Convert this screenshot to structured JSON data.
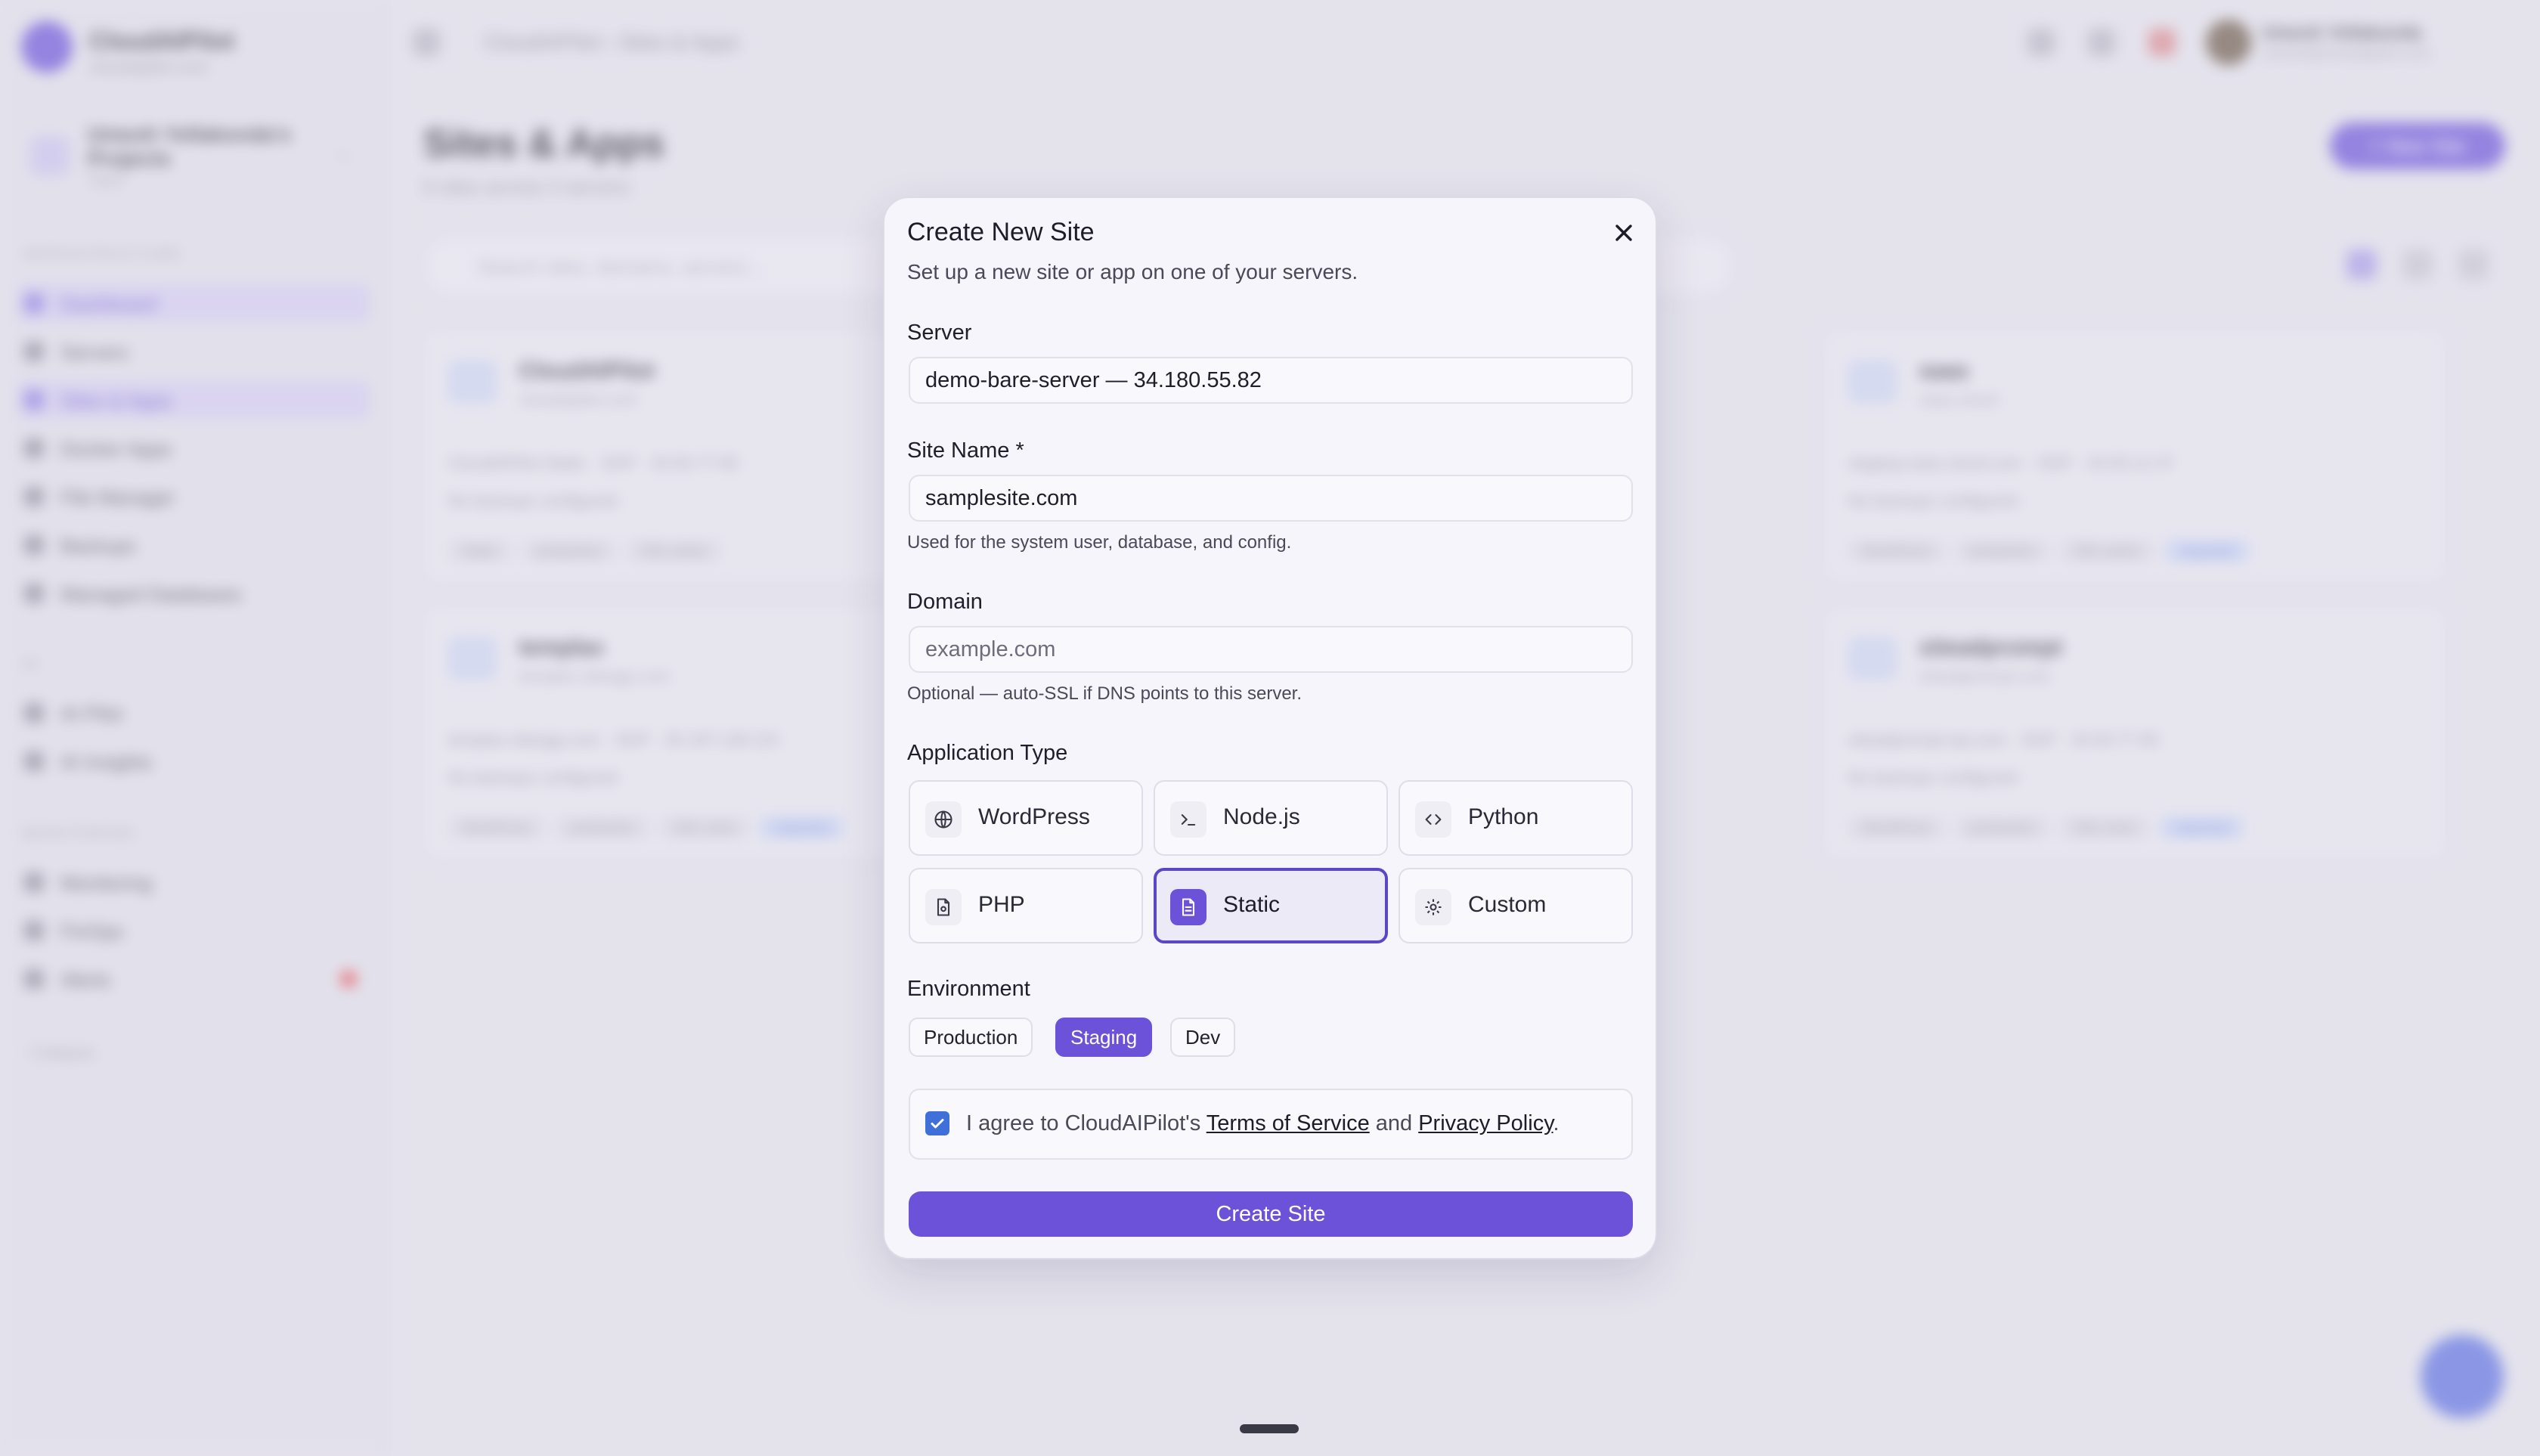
{
  "sidebar": {
    "brand": "CloudAIPilot",
    "brand_sub": "cloudaipilot.com",
    "project_name": "Umesh Yellakonda's Projects",
    "project_sub": "Team",
    "sections": {
      "infrastructure": "INFRASTRUCTURE",
      "ai": "AI",
      "monitoring": "MONITORING"
    },
    "items": [
      {
        "label": "Dashboard",
        "icon": "grid-icon"
      },
      {
        "label": "Servers",
        "icon": "server-icon"
      },
      {
        "label": "Sites & Apps",
        "icon": "globe-icon"
      },
      {
        "label": "Docker Apps",
        "icon": "container-icon"
      },
      {
        "label": "File Manager",
        "icon": "folder-icon"
      },
      {
        "label": "Backups",
        "icon": "archive-icon"
      },
      {
        "label": "Managed Databases",
        "icon": "database-icon"
      },
      {
        "label": "AI Pilot",
        "icon": "chat-icon"
      },
      {
        "label": "AI Insights",
        "icon": "sparkle-icon"
      },
      {
        "label": "Monitoring",
        "icon": "activity-icon"
      },
      {
        "label": "FinOps",
        "icon": "chart-icon"
      },
      {
        "label": "Alerts",
        "icon": "bell-icon"
      }
    ],
    "collapse": "Collapse"
  },
  "topbar": {
    "breadcrumb_root": "CloudAIPilot",
    "breadcrumb_current": "Sites & Apps",
    "user_name": "Umesh Yellakonda",
    "user_email": "umesh@cloudaipilot.com"
  },
  "page": {
    "title": "Sites & Apps",
    "subtitle": "6 sites across 3 servers",
    "new_site": "+ New Site",
    "search_placeholder": "Search sites, domains, servers..."
  },
  "cards": [
    {
      "icon": "HTML",
      "title": "CloudAIPilot",
      "sub": "cloudaipilot.com",
      "line1": "CloudAIPilot-Static · SGP · 34.93.77.90",
      "line2": "No backups configured",
      "tags": [
        "Static",
        "production",
        "SSL active"
      ]
    },
    {
      "icon": "WP",
      "title": "saas",
      "sub": "saas.cloud",
      "line1": "staging-saas.cloud.com · SGP · 34.93.12.37",
      "line2": "No backups configured",
      "tags": [
        "WordPress",
        "production",
        "SSL active",
        "Imported"
      ]
    },
    {
      "icon": "WP",
      "title": "templax",
      "sub": "templax.sitesgp.com",
      "line1": "templax-sitesgp.com · SGP · 35.197.139.115",
      "line2": "No backups configured",
      "tags": [
        "WordPress",
        "production",
        "SSL none",
        "Imported"
      ]
    },
    {
      "icon": "WP",
      "title": "siteadprompt",
      "sub": "siteadprompt.com",
      "line1": "siteadprompt-wp.com · SGP · 34.93.77.90",
      "line2": "No backups configured",
      "tags": [
        "WordPress",
        "production",
        "SSL none",
        "Imported"
      ]
    }
  ],
  "modal": {
    "title": "Create New Site",
    "subtitle": "Set up a new site or app on one of your servers.",
    "server_label": "Server",
    "server_value": "demo-bare-server — 34.180.55.82",
    "site_name_label": "Site Name *",
    "site_name_value": "samplesite.com",
    "site_name_help": "Used for the system user, database, and config.",
    "domain_label": "Domain",
    "domain_placeholder": "example.com",
    "domain_help": "Optional — auto-SSL if DNS points to this server.",
    "app_type_label": "Application Type",
    "app_types": [
      {
        "label": "WordPress",
        "icon": "globe-icon"
      },
      {
        "label": "Node.js",
        "icon": "terminal-icon"
      },
      {
        "label": "Python",
        "icon": "code-icon"
      },
      {
        "label": "PHP",
        "icon": "php-file-icon"
      },
      {
        "label": "Static",
        "icon": "document-icon",
        "selected": true
      },
      {
        "label": "Custom",
        "icon": "gear-icon"
      }
    ],
    "env_label": "Environment",
    "environments": [
      "Production",
      "Staging",
      "Dev"
    ],
    "selected_environment": "Staging",
    "agree_prefix": "I agree to CloudAIPilot's ",
    "terms": "Terms of Service",
    "agree_and": " and ",
    "privacy": "Privacy Policy",
    "agree_suffix": ".",
    "agree_checked": true,
    "create_button": "Create Site"
  },
  "colors": {
    "accent": "#6b52d9",
    "checkbox": "#3f6fd8",
    "modal_bg": "#f6f5fb"
  }
}
